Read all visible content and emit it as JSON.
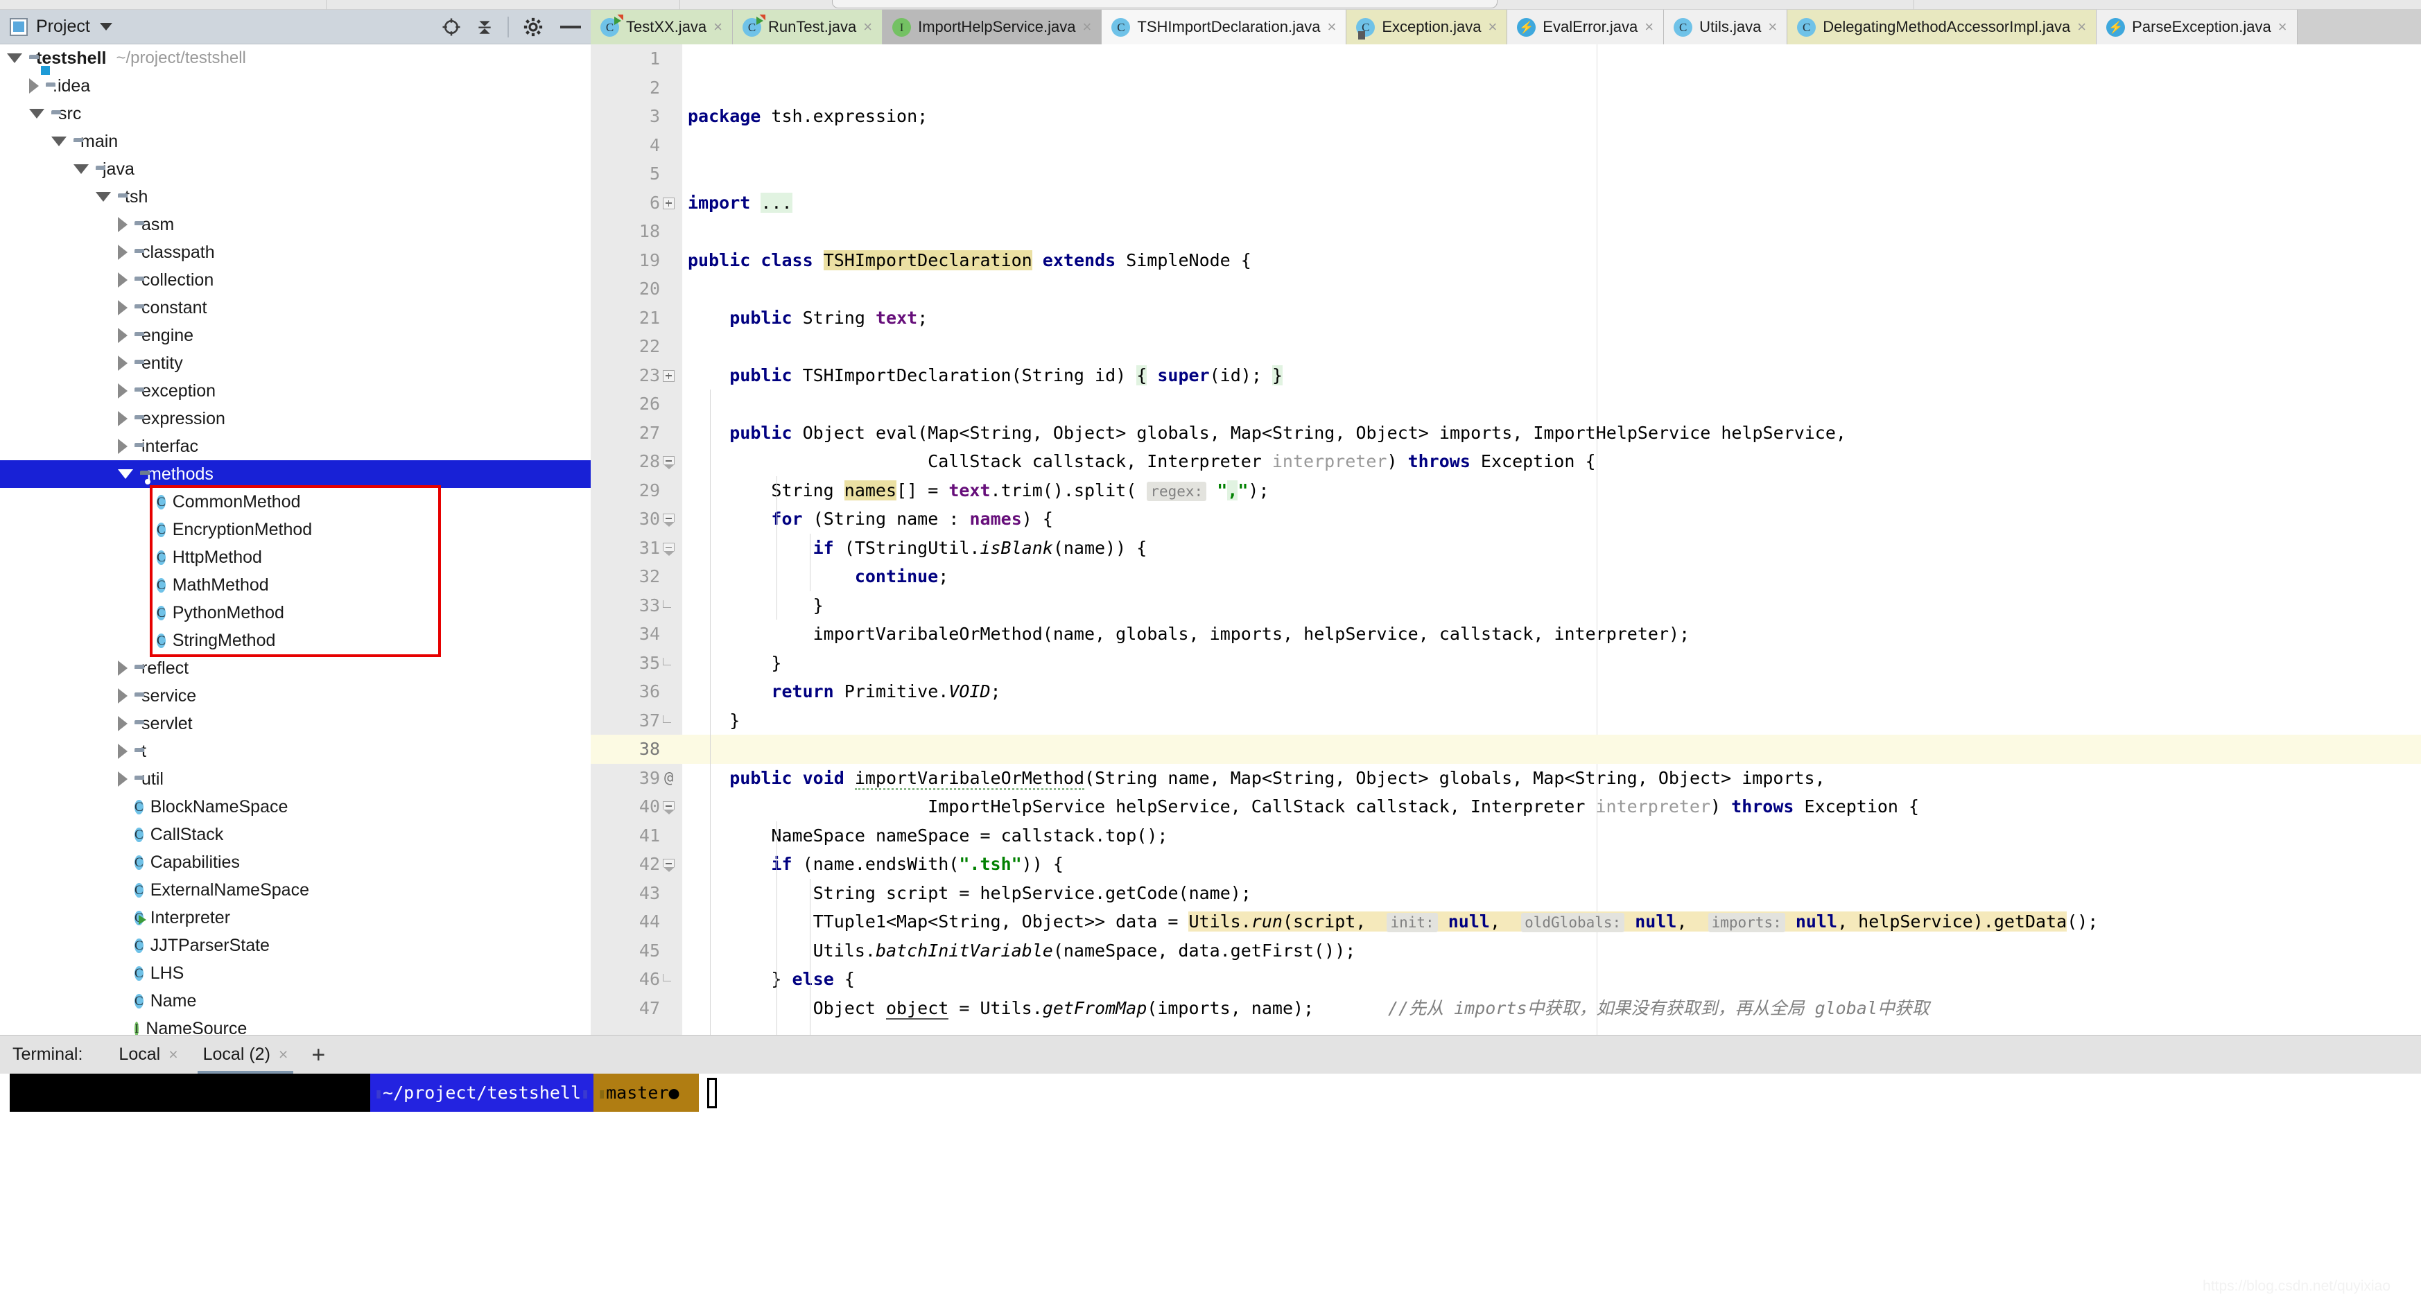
{
  "window": {
    "tool_window_title": "Project",
    "project_root": "testshell",
    "project_path": "~/project/testshell"
  },
  "toolbar_icons": [
    "locate-icon",
    "collapse-all-icon",
    "settings-gear-icon",
    "hide-icon"
  ],
  "tree": [
    {
      "label": "testshell",
      "path": "~/project/testshell",
      "depth": 0,
      "arrow": "open",
      "icon": "module-folder-icon",
      "bold": true
    },
    {
      "label": ".idea",
      "depth": 1,
      "arrow": "closed",
      "icon": "folder-icon"
    },
    {
      "label": "src",
      "depth": 1,
      "arrow": "open",
      "icon": "folder-icon"
    },
    {
      "label": "main",
      "depth": 2,
      "arrow": "open",
      "icon": "folder-icon"
    },
    {
      "label": "java",
      "depth": 3,
      "arrow": "open",
      "icon": "source-root-folder-icon"
    },
    {
      "label": "tsh",
      "depth": 4,
      "arrow": "open",
      "icon": "package-folder-icon"
    },
    {
      "label": "asm",
      "depth": 5,
      "arrow": "closed",
      "icon": "package-folder-icon"
    },
    {
      "label": "classpath",
      "depth": 5,
      "arrow": "closed",
      "icon": "package-folder-icon"
    },
    {
      "label": "collection",
      "depth": 5,
      "arrow": "closed",
      "icon": "package-folder-icon"
    },
    {
      "label": "constant",
      "depth": 5,
      "arrow": "closed",
      "icon": "package-folder-icon"
    },
    {
      "label": "engine",
      "depth": 5,
      "arrow": "closed",
      "icon": "package-folder-icon"
    },
    {
      "label": "entity",
      "depth": 5,
      "arrow": "closed",
      "icon": "package-folder-icon"
    },
    {
      "label": "exception",
      "depth": 5,
      "arrow": "closed",
      "icon": "package-folder-icon"
    },
    {
      "label": "expression",
      "depth": 5,
      "arrow": "closed",
      "icon": "package-folder-icon"
    },
    {
      "label": "interfac",
      "depth": 5,
      "arrow": "closed",
      "icon": "package-folder-icon"
    },
    {
      "label": "methods",
      "depth": 5,
      "arrow": "open",
      "icon": "package-folder-icon",
      "selected": true
    },
    {
      "label": "CommonMethod",
      "depth": 6,
      "arrow": "none",
      "icon": "java-class-icon"
    },
    {
      "label": "EncryptionMethod",
      "depth": 6,
      "arrow": "none",
      "icon": "java-class-icon"
    },
    {
      "label": "HttpMethod",
      "depth": 6,
      "arrow": "none",
      "icon": "java-class-icon"
    },
    {
      "label": "MathMethod",
      "depth": 6,
      "arrow": "none",
      "icon": "java-class-icon"
    },
    {
      "label": "PythonMethod",
      "depth": 6,
      "arrow": "none",
      "icon": "java-class-icon"
    },
    {
      "label": "StringMethod",
      "depth": 6,
      "arrow": "none",
      "icon": "java-class-icon"
    },
    {
      "label": "reflect",
      "depth": 5,
      "arrow": "closed",
      "icon": "package-folder-icon"
    },
    {
      "label": "service",
      "depth": 5,
      "arrow": "closed",
      "icon": "package-folder-icon"
    },
    {
      "label": "servlet",
      "depth": 5,
      "arrow": "closed",
      "icon": "package-folder-icon"
    },
    {
      "label": "t",
      "depth": 5,
      "arrow": "closed",
      "icon": "package-folder-icon"
    },
    {
      "label": "util",
      "depth": 5,
      "arrow": "closed",
      "icon": "package-folder-icon"
    },
    {
      "label": "BlockNameSpace",
      "depth": 5,
      "arrow": "none",
      "icon": "java-class-icon"
    },
    {
      "label": "CallStack",
      "depth": 5,
      "arrow": "none",
      "icon": "java-class-icon"
    },
    {
      "label": "Capabilities",
      "depth": 5,
      "arrow": "none",
      "icon": "java-class-icon"
    },
    {
      "label": "ExternalNameSpace",
      "depth": 5,
      "arrow": "none",
      "icon": "java-class-icon"
    },
    {
      "label": "Interpreter",
      "depth": 5,
      "arrow": "none",
      "icon": "java-class-runnable-icon"
    },
    {
      "label": "JJTParserState",
      "depth": 5,
      "arrow": "none",
      "icon": "java-class-icon"
    },
    {
      "label": "LHS",
      "depth": 5,
      "arrow": "none",
      "icon": "java-class-icon"
    },
    {
      "label": "Name",
      "depth": 5,
      "arrow": "none",
      "icon": "java-class-icon"
    },
    {
      "label": "NameSource",
      "depth": 5,
      "arrow": "none",
      "icon": "java-interface-icon"
    }
  ],
  "highlight_box": {
    "color": "#e60000",
    "label": "methods-classes-highlight"
  },
  "tabs": [
    {
      "label": "TestXX.java",
      "icon": "java-test-class-icon",
      "style": "green",
      "close": "×"
    },
    {
      "label": "RunTest.java",
      "icon": "java-test-class-icon",
      "style": "green",
      "close": "×"
    },
    {
      "label": "ImportHelpService.java",
      "icon": "java-interface-icon",
      "style": "grey",
      "close": "×"
    },
    {
      "label": "TSHImportDeclaration.java",
      "icon": "java-class-icon",
      "style": "active",
      "close": "×",
      "active": true
    },
    {
      "label": "Exception.java",
      "icon": "java-class-lib-icon",
      "style": "yellow",
      "close": "×"
    },
    {
      "label": "EvalError.java",
      "icon": "java-exception-icon",
      "style": "white",
      "close": "×"
    },
    {
      "label": "Utils.java",
      "icon": "java-class-icon",
      "style": "white",
      "close": "×"
    },
    {
      "label": "DelegatingMethodAccessorImpl.java",
      "icon": "java-class-icon",
      "style": "yellow",
      "close": "×"
    },
    {
      "label": "ParseException.java",
      "icon": "java-exception-icon",
      "style": "white",
      "close": "×"
    }
  ],
  "editor": {
    "filename": "TSHImportDeclaration.java",
    "current_line": 38,
    "lines": [
      {
        "num": "1",
        "text": ""
      },
      {
        "num": "2",
        "text": ""
      },
      {
        "num": "3",
        "text": "package tsh.expression;"
      },
      {
        "num": "4",
        "text": ""
      },
      {
        "num": "5",
        "text": ""
      },
      {
        "num": "6",
        "text": "import ...",
        "fold": "plus"
      },
      {
        "num": "18",
        "text": ""
      },
      {
        "num": "19",
        "text": "public class TSHImportDeclaration extends SimpleNode {"
      },
      {
        "num": "20",
        "text": ""
      },
      {
        "num": "21",
        "text": "    public String text;"
      },
      {
        "num": "22",
        "text": ""
      },
      {
        "num": "23",
        "text": "    public TSHImportDeclaration(String id) { super(id); }",
        "fold": "plus"
      },
      {
        "num": "26",
        "text": ""
      },
      {
        "num": "27",
        "text": "    public Object eval(Map<String, Object> globals, Map<String, Object> imports, ImportHelpService helpService,"
      },
      {
        "num": "28",
        "text": "                       CallStack callstack, Interpreter interpreter) throws Exception {",
        "fold": "top"
      },
      {
        "num": "29",
        "text": "        String names[] = text.trim().split( regex: \",\");"
      },
      {
        "num": "30",
        "text": "        for (String name : names) {",
        "fold": "top"
      },
      {
        "num": "31",
        "text": "            if (TStringUtil.isBlank(name)) {",
        "fold": "top"
      },
      {
        "num": "32",
        "text": "                continue;"
      },
      {
        "num": "33",
        "text": "            }",
        "fold": "end"
      },
      {
        "num": "34",
        "text": "            importVaribaleOrMethod(name, globals, imports, helpService, callstack, interpreter);"
      },
      {
        "num": "35",
        "text": "        }",
        "fold": "end"
      },
      {
        "num": "36",
        "text": "        return Primitive.VOID;"
      },
      {
        "num": "37",
        "text": "    }",
        "fold": "end"
      },
      {
        "num": "38",
        "text": "",
        "current": true
      },
      {
        "num": "39",
        "text": "    public void importVaribaleOrMethod(String name, Map<String, Object> globals, Map<String, Object> imports,",
        "gutter_mark": "@"
      },
      {
        "num": "40",
        "text": "                       ImportHelpService helpService, CallStack callstack, Interpreter interpreter) throws Exception {",
        "fold": "top"
      },
      {
        "num": "41",
        "text": "        NameSpace nameSpace = callstack.top();"
      },
      {
        "num": "42",
        "text": "        if (name.endsWith(\".tsh\")) {",
        "fold": "top"
      },
      {
        "num": "43",
        "text": "            String script = helpService.getCode(name);"
      },
      {
        "num": "44",
        "text": "            TTuple1<Map<String, Object>> data = Utils.run(script,  init: null,  oldGlobals: null,  imports: null, helpService).getData();"
      },
      {
        "num": "45",
        "text": "            Utils.batchInitVariable(nameSpace, data.getFirst());"
      },
      {
        "num": "46",
        "text": "        } else {",
        "fold": "end"
      },
      {
        "num": "47",
        "text": "            Object object = Utils.getFromMap(imports, name);",
        "comment": "//先从 imports中获取，如果没有获取到，再从全局 global中获取"
      }
    ]
  },
  "terminal": {
    "label": "Terminal:",
    "tabs": [
      {
        "label": "Local",
        "close": "×",
        "active": false
      },
      {
        "label": "Local (2)",
        "close": "×",
        "active": true
      }
    ],
    "add_label": "+",
    "prompt_path": "~/project/testshell",
    "prompt_branch": "master",
    "prompt_dirty": "●"
  },
  "watermark": "https://blog.csdn.net/quyixiao",
  "colors": {
    "selection_blue": "#1821d6",
    "highlight_red": "#e60000",
    "identifier_highlight": "#ebe0a3",
    "current_line": "#fcfae3",
    "keyword": "#000080",
    "string": "#008000",
    "field": "#660e7a"
  }
}
